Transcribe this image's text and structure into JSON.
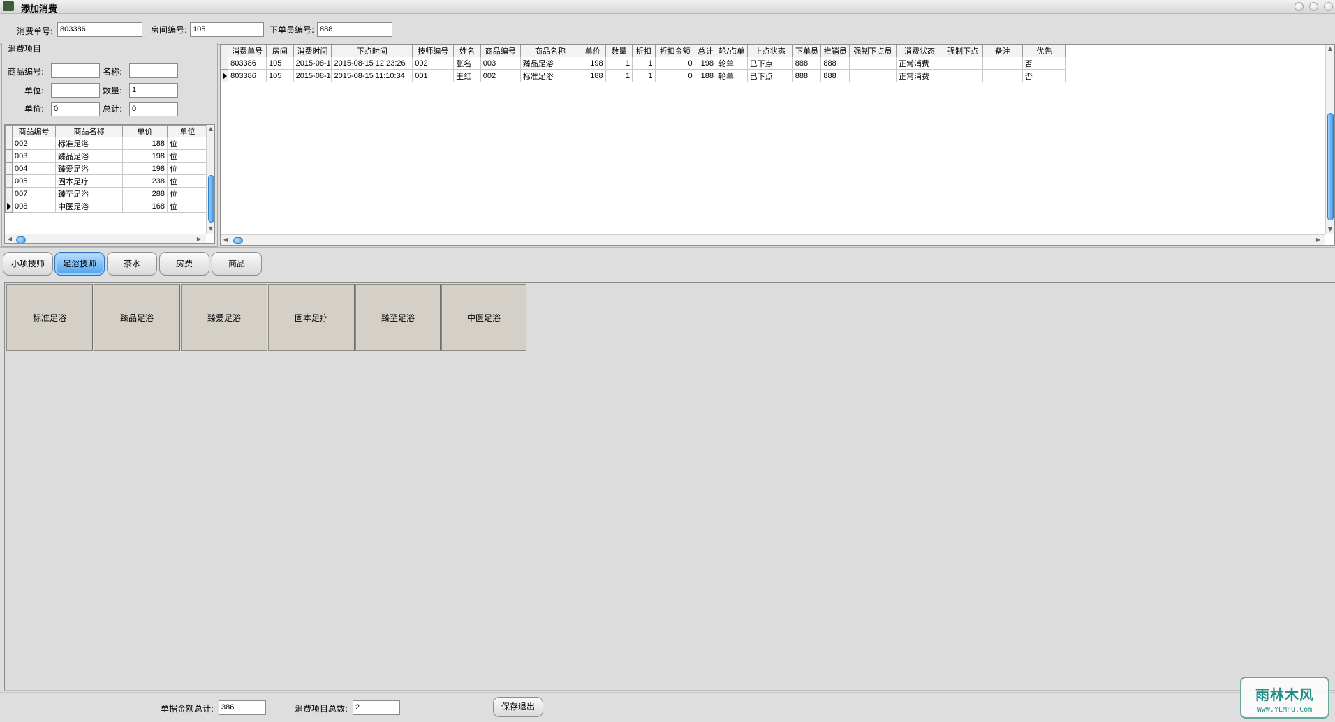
{
  "window": {
    "title": "添加消费"
  },
  "header": {
    "order_no_label": "消费单号:",
    "order_no": "803386",
    "room_no_label": "房间编号:",
    "room_no": "105",
    "staff_no_label": "下单员编号:",
    "staff_no": "888"
  },
  "item_form": {
    "group_title": "消费项目",
    "product_code_label": "商品编号:",
    "product_code": "",
    "name_label": "名称:",
    "name": "",
    "unit_label": "单位:",
    "unit": "",
    "qty_label": "数量:",
    "qty": "1",
    "price_label": "单价:",
    "price": "0",
    "total_label": "总计:",
    "total": "0"
  },
  "product_grid": {
    "columns": [
      "商品编号",
      "商品名称",
      "单价",
      "单位"
    ],
    "rows": [
      [
        "002",
        "标准足浴",
        "188",
        "位"
      ],
      [
        "003",
        "臻品足浴",
        "198",
        "位"
      ],
      [
        "004",
        "臻爱足浴",
        "198",
        "位"
      ],
      [
        "005",
        "固本足疗",
        "238",
        "位"
      ],
      [
        "007",
        "臻至足浴",
        "288",
        "位"
      ],
      [
        "008",
        "中医足浴",
        "168",
        "位"
      ]
    ]
  },
  "order_grid": {
    "columns": [
      "消费单号",
      "房间",
      "消费时间",
      "下点时间",
      "技师编号",
      "姓名",
      "商品编号",
      "商品名称",
      "单价",
      "数量",
      "折扣",
      "折扣金额",
      "总计",
      "轮/点单",
      "上点状态",
      "下单员",
      "推销员",
      "强制下点员",
      "消费状态",
      "强制下点",
      "备注",
      "优先"
    ],
    "rows": [
      [
        "803386",
        "105",
        "2015-08-1",
        "2015-08-15 12:23:26",
        "002",
        "张名",
        "003",
        "臻品足浴",
        "198",
        "1",
        "1",
        "0",
        "198",
        "轮单",
        "已下点",
        "888",
        "888",
        "",
        "正常消费",
        "",
        "",
        "否"
      ],
      [
        "803386",
        "105",
        "2015-08-1",
        "2015-08-15 11:10:34",
        "001",
        "王红",
        "002",
        "标准足浴",
        "188",
        "1",
        "1",
        "0",
        "188",
        "轮单",
        "已下点",
        "888",
        "888",
        "",
        "正常消费",
        "",
        "",
        "否"
      ]
    ]
  },
  "tabs": [
    {
      "label": "小项技师",
      "active": false
    },
    {
      "label": "足浴技师",
      "active": true
    },
    {
      "label": "茶水",
      "active": false
    },
    {
      "label": "房费",
      "active": false
    },
    {
      "label": "商品",
      "active": false
    }
  ],
  "item_buttons": [
    "标准足浴",
    "臻品足浴",
    "臻爱足浴",
    "固本足疗",
    "臻至足浴",
    "中医足浴"
  ],
  "footer": {
    "amount_total_label": "单据金额总计:",
    "amount_total": "386",
    "item_count_label": "消费项目总数:",
    "item_count": "2",
    "save_exit": "保存退出"
  },
  "watermark": {
    "top": "雨林木风",
    "bottom": "WwW.YLMFU.Com"
  }
}
